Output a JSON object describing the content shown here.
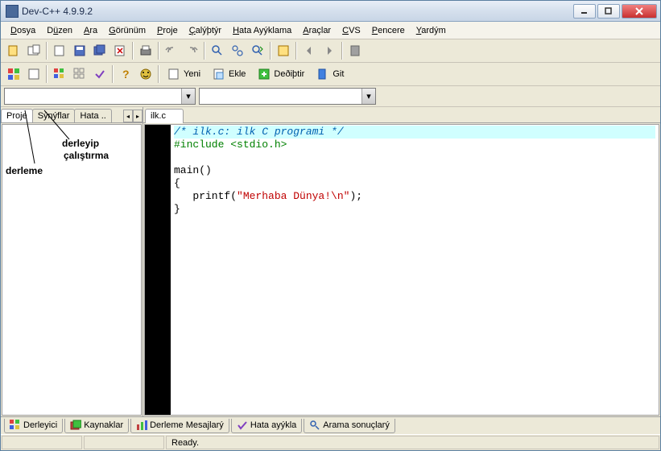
{
  "window": {
    "title": "Dev-C++ 4.9.9.2"
  },
  "menu": {
    "dosya": "Dosya",
    "d_u": "D",
    "duzen": "Düzen",
    "du_u": "ü",
    "ara": "Ara",
    "a_u": "A",
    "gorunum": "Görünüm",
    "g_u": "G",
    "proje": "Proje",
    "p_u": "P",
    "calistir": "Çalýþtýr",
    "c_u": "Ç",
    "hata": "Hata Ayýklama",
    "h_u": "H",
    "araclar": "Araçlar",
    "ar_u": "A",
    "cvs": "CVS",
    "cv_u": "C",
    "pencere": "Pencere",
    "pe_u": "P",
    "yardim": "Yardým",
    "y_u": "Y"
  },
  "toolbar2": {
    "yeni": "Yeni",
    "ekle": "Ekle",
    "degistir": "Deðiþtir",
    "git": "Git"
  },
  "leftTabs": {
    "t1": "Proje",
    "t2": "Sýnýflar",
    "t3": "Hata .."
  },
  "fileTab": "ilk.c",
  "code": {
    "l1": "/* ilk.c: ilk C programi */",
    "l2": "#include <stdio.h>",
    "l3": "",
    "l4": "main()",
    "l5": "{",
    "l6_a": "   printf(",
    "l6_b": "\"Merhaba Dünya!\\n\"",
    "l6_c": ");",
    "l7": "}"
  },
  "bottomTabs": {
    "b1": "Derleyici",
    "b2": "Kaynaklar",
    "b3": "Derleme Mesajlarý",
    "b4": "Hata ayýkla",
    "b5": "Arama sonuçlarý"
  },
  "status": {
    "ready": "Ready."
  },
  "annot": {
    "a1": "derleme",
    "a2_1": "derleyip",
    "a2_2": "çalıştırma"
  }
}
